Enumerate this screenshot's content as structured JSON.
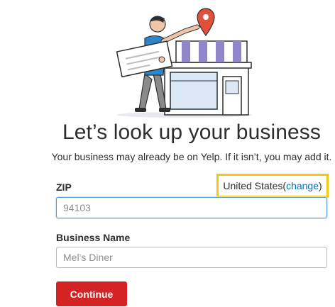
{
  "heading": "Let’s look up your business",
  "subheading": "Your business may already be on Yelp. If it isn’t, you may add it.",
  "zip": {
    "label": "ZIP",
    "placeholder": "94103",
    "value": ""
  },
  "country": {
    "name": "United States",
    "open_paren": " (",
    "change_label": "change",
    "close_paren": ")"
  },
  "business_name": {
    "label": "Business Name",
    "placeholder": "Mel’s Diner",
    "value": ""
  },
  "continue_label": "Continue",
  "colors": {
    "brand_red": "#d32323",
    "link_blue": "#0073bb",
    "highlight_yellow": "#f5c518",
    "awning_purple": "#8f86c9",
    "pin_red": "#e0503b",
    "shirt_blue": "#2e86c9"
  }
}
